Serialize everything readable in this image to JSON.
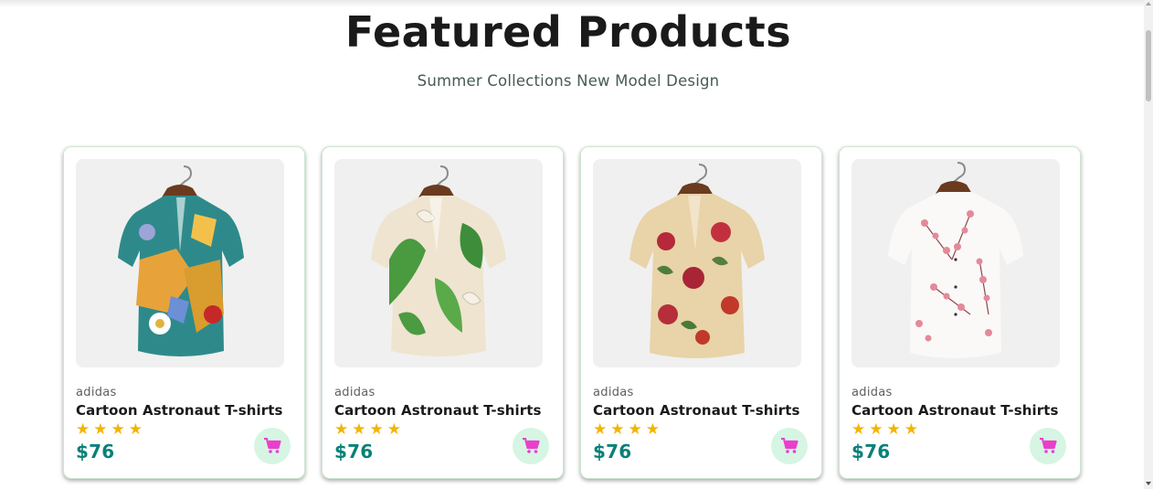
{
  "section": {
    "title": "Featured Products",
    "subtitle": "Summer Collections New Model Design"
  },
  "colors": {
    "price": "#088178",
    "star": "#f3b500",
    "cart_bg": "#d6f5e3",
    "cart_icon": "#ea3fcd"
  },
  "products": [
    {
      "brand": "adidas",
      "name": "Cartoon Astronaut T-shirts",
      "price": "$76",
      "rating": 4,
      "image_icon": "shirt-colorful-print-icon"
    },
    {
      "brand": "adidas",
      "name": "Cartoon Astronaut T-shirts",
      "price": "$76",
      "rating": 4,
      "image_icon": "shirt-green-leaf-print-icon"
    },
    {
      "brand": "adidas",
      "name": "Cartoon Astronaut T-shirts",
      "price": "$76",
      "rating": 4,
      "image_icon": "shirt-red-floral-print-icon"
    },
    {
      "brand": "adidas",
      "name": "Cartoon Astronaut T-shirts",
      "price": "$76",
      "rating": 4,
      "image_icon": "shirt-pink-blossom-print-icon"
    }
  ]
}
